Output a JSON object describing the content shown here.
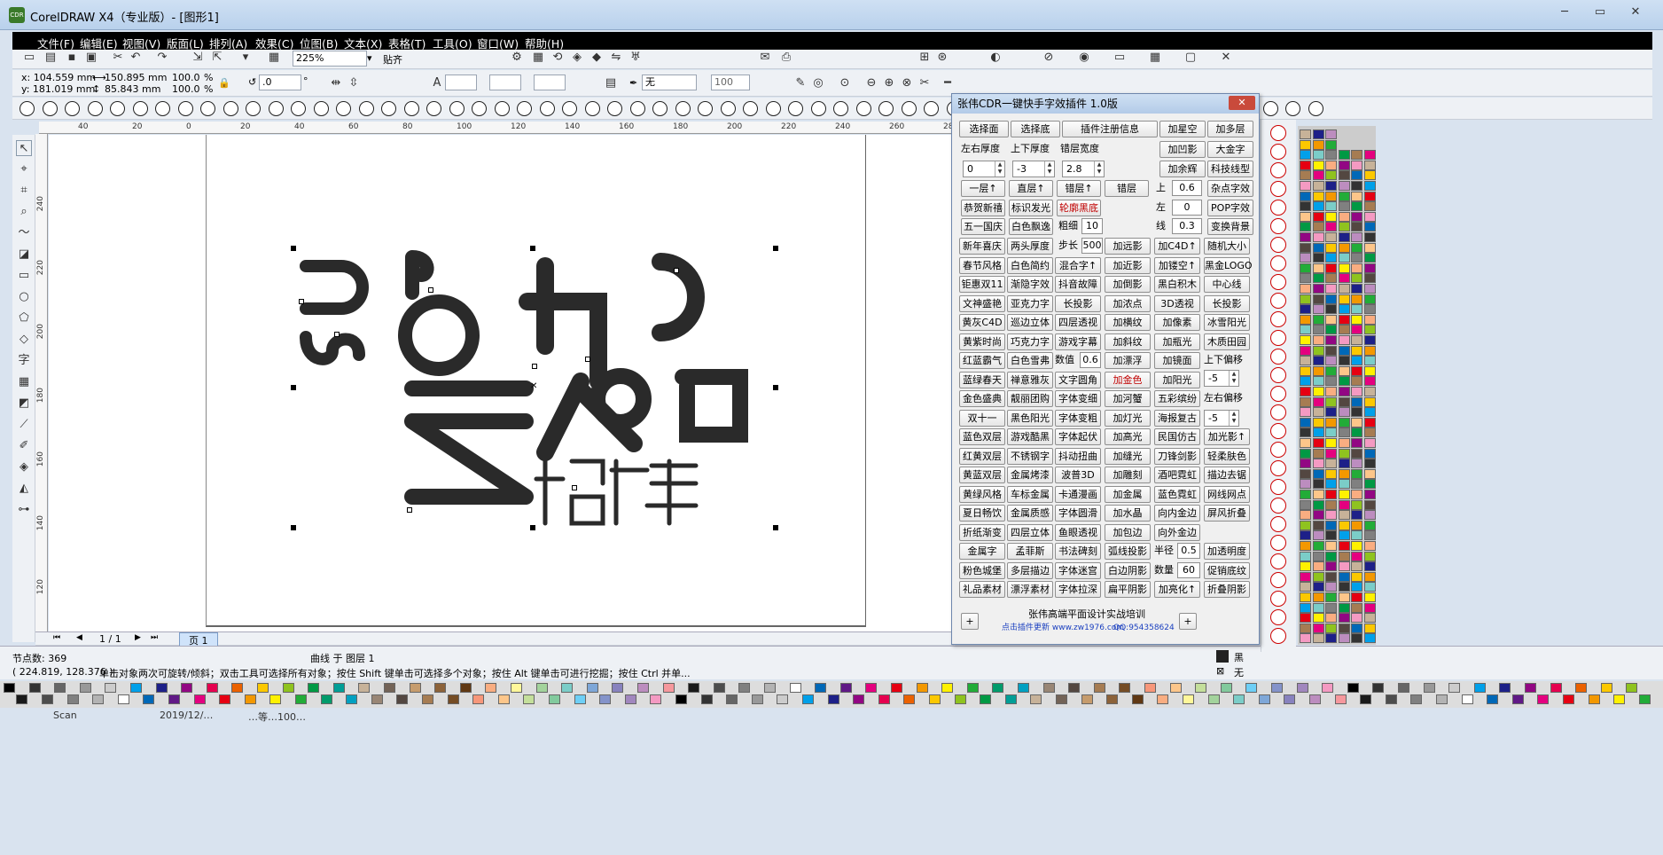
{
  "window": {
    "title": "CorelDRAW X4（专业版）- [图形1]",
    "app_icon": "CDR"
  },
  "menu": [
    "文件(F)",
    "编辑(E)",
    "视图(V)",
    "版面(L)",
    "排列(A)",
    "效果(C)",
    "位图(B)",
    "文本(X)",
    "表格(T)",
    "工具(O)",
    "窗口(W)",
    "帮助(H)"
  ],
  "toolbar": {
    "zoom": "225%",
    "snap": "贴齐"
  },
  "property_bar": {
    "x": "x: 104.559 mm",
    "y": "y: 181.019 mm",
    "w": "150.895 mm",
    "h": "85.843 mm",
    "sx": "100.0",
    "sy": "100.0",
    "pct": "%",
    "angle": ".0",
    "deg": "°",
    "outline": "无",
    "outline_width": "100"
  },
  "ruler_top": [
    "40",
    "20",
    "0",
    "20",
    "40",
    "60",
    "80",
    "100",
    "120",
    "140",
    "160",
    "180",
    "200",
    "220",
    "240",
    "260",
    "280"
  ],
  "ruler_left": [
    "240",
    "220",
    "200",
    "180",
    "160",
    "140",
    "120"
  ],
  "page_nav": {
    "counter": "1 / 1",
    "tab": "页 1"
  },
  "status": {
    "nodes": "节点数: 369",
    "object": "曲线 于 图层 1",
    "coords": "( 224.819, 128.376 )",
    "hint": "单击对象两次可旋转/倾斜；双击工具可选择所有对象；按住 Shift 键单击可选择多个对象；按住 Alt 键单击可进行挖掘；按住 Ctrl 并单...",
    "fill": "黑",
    "outline": "无"
  },
  "footer": {
    "frag1": "Scan",
    "frag2": "2019/12/…",
    "frag3": "…等…100…"
  },
  "artwork": {
    "main": "加您",
    "vertical_latin": "JOIN US",
    "sub": "招聘"
  },
  "plugin": {
    "title": "张伟CDR一键快手字效插件 1.0版",
    "close": "✕",
    "row1": [
      "选择面",
      "选择底",
      "插件注册信息",
      "加星空",
      "加多层"
    ],
    "labels_thick": {
      "lr": "左右厚度",
      "ud": "上下厚度",
      "stagger": "错层宽度"
    },
    "spin_values": {
      "lr": "0",
      "ud": "-3",
      "stagger": "2.8"
    },
    "right_col": [
      "加凹影",
      "大金字",
      "加余辉",
      "科技线型"
    ],
    "row_layers": [
      "一层↑",
      "直层↑",
      "错层↑",
      "错层"
    ],
    "offsets": {
      "up_label": "上",
      "up_val": "0.6",
      "left_label": "左",
      "left_val": "0",
      "line_label": "线",
      "line_val": "0.3"
    },
    "offset_btns": [
      "杂点字效",
      "POP字效",
      "变换背景"
    ],
    "row_a": [
      "恭贺新禧",
      "标识发光",
      "轮廓黑底"
    ],
    "row_b_left": [
      "五一国庆",
      "白色飘逸"
    ],
    "coarse_label": "粗细",
    "coarse_val": "10",
    "step_label": "步长",
    "step_val": "500",
    "grid_rows": [
      [
        "新年喜庆",
        "两头厚度",
        "",
        "加远影",
        "加C4D↑",
        "随机大小"
      ],
      [
        "春节风格",
        "白色简约",
        "混合字↑",
        "加近影",
        "加镂空↑",
        "黑金LOGO"
      ],
      [
        "钜惠双11",
        "渐隐字效",
        "抖音故障",
        "加倒影",
        "黑白积木",
        "中心线"
      ],
      [
        "文神盛艳",
        "亚克力字",
        "长投影",
        "加浓点",
        "3D透视",
        "长投影"
      ],
      [
        "黄灰C4D",
        "巡边立体",
        "四层透视",
        "加横纹",
        "加像素",
        "冰雪阳光"
      ],
      [
        "黄紫时尚",
        "巧克力字",
        "游戏字幕",
        "加斜纹",
        "加瓶光",
        "木质田园"
      ]
    ],
    "row_red": [
      "红蓝霸气",
      "白色雪弗"
    ],
    "num_label": "数值",
    "num_val": "0.6",
    "row_red_right": [
      "加漂浮",
      "加镜面"
    ],
    "up_shift": "上下偏移",
    "up_shift_val": "-5",
    "row_blue": [
      "蓝绿春天",
      "禅意雅灰",
      "文字圆角",
      "加金色",
      "加阳光"
    ],
    "lr_shift": "左右偏移",
    "lr_shift_val": "-5",
    "rows_more": [
      [
        "金色盛典",
        "靓丽团购",
        "字体变细",
        "加河蟹",
        "五彩缤纷"
      ],
      [
        "双十一",
        "黑色阳光",
        "字体变粗",
        "加灯光",
        "海报复古"
      ],
      [
        "蓝色双层",
        "游戏酷黑",
        "字体起伏",
        "加高光",
        "民国仿古",
        "加光影↑"
      ],
      [
        "红黄双层",
        "不锈钢字",
        "抖动扭曲",
        "加缝光",
        "刀锋剑影",
        "轻柔肤色"
      ],
      [
        "黄蓝双层",
        "金属烤漆",
        "波普3D",
        "加雕刻",
        "酒吧霓虹",
        "描边去锯"
      ],
      [
        "黄绿风格",
        "车标金属",
        "卡通漫画",
        "加金属",
        "蓝色霓虹",
        "网线网点"
      ],
      [
        "夏日畅饮",
        "金属质感",
        "字体圆滑",
        "加水晶",
        "向内金边",
        "屏风折叠"
      ],
      [
        "折纸渐变",
        "四层立体",
        "鱼眼透视",
        "加包边",
        "向外金边",
        ""
      ]
    ],
    "row_gold": [
      "金属字",
      "孟菲斯",
      "书法碑刻",
      "弧线投影"
    ],
    "radius_label": "半径",
    "radius_val": "0.5",
    "transp": "加透明度",
    "row_powder": [
      "粉色城堡",
      "多层描边",
      "字体迷宫",
      "白边阴影"
    ],
    "qty_label": "数量",
    "qty_val": "60",
    "promo": "促销底纹",
    "row_gift": [
      "礼品素材",
      "漂浮素材",
      "字体拉深",
      "扁平阴影",
      "加亮化↑",
      "折叠阴影"
    ],
    "footer_title": "张伟高端平面设计实战培训",
    "footer_link": "点击插件更新 www.zw1976.com",
    "footer_qq": "QQ:954358624",
    "plus": "+"
  },
  "colors": {
    "accent_red": "#c00000",
    "link_blue": "#1a3fbf",
    "art": "#2a2a2a"
  }
}
